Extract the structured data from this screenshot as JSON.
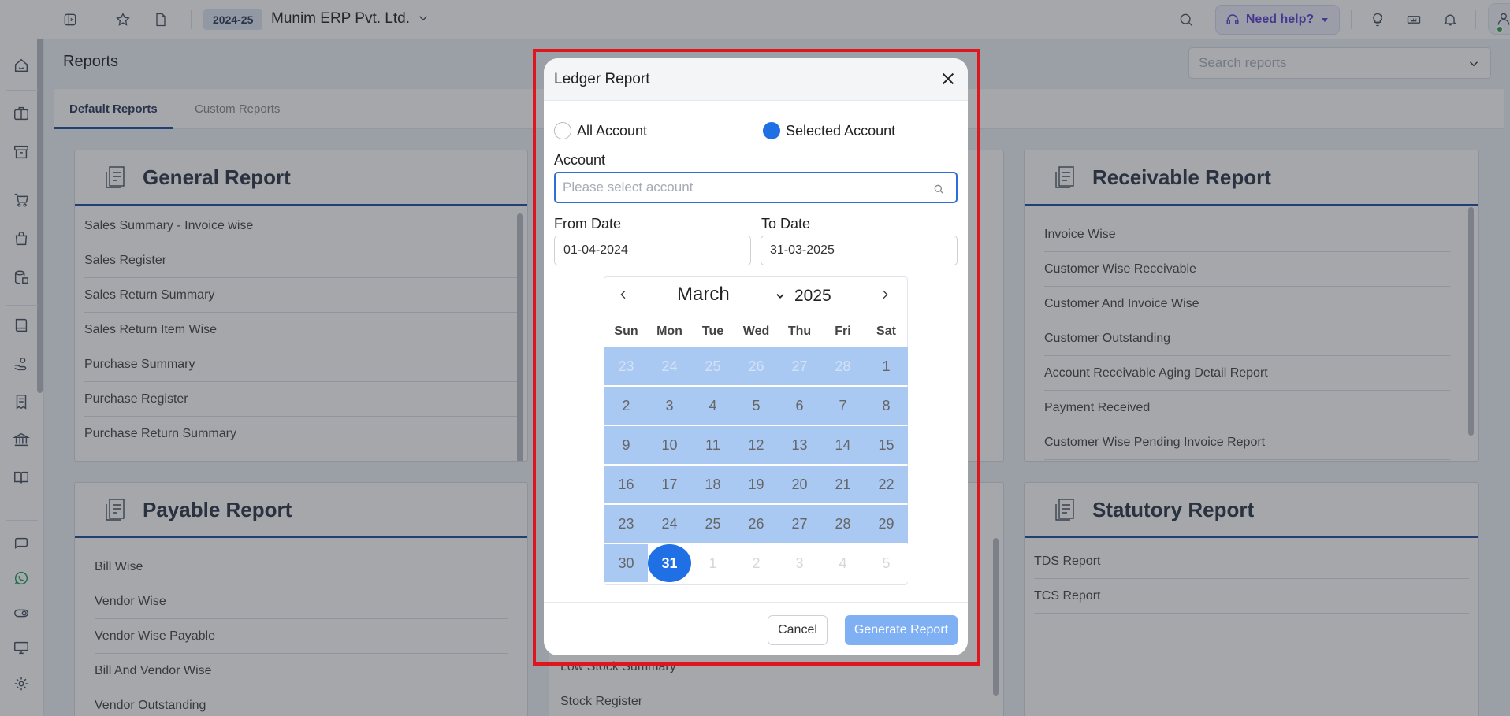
{
  "topbar": {
    "fy_badge": "2024-25",
    "company": "Munim ERP Pvt. Ltd.",
    "help_label": "Need help?"
  },
  "page": {
    "title": "Reports",
    "search_placeholder": "Search reports"
  },
  "tabs": [
    "Default Reports",
    "Custom Reports"
  ],
  "cards": {
    "general": {
      "title": "General Report",
      "items": [
        "Sales Summary - Invoice wise",
        "Sales Register",
        "Sales Return Summary",
        "Sales Return Item Wise",
        "Purchase Summary",
        "Purchase Register",
        "Purchase Return Summary"
      ]
    },
    "receivable": {
      "title": "Receivable Report",
      "items": [
        "Invoice Wise",
        "Customer Wise Receivable",
        "Customer And Invoice Wise",
        "Customer Outstanding",
        "Account Receivable Aging Detail Report",
        "Payment Received",
        "Customer Wise Pending Invoice Report"
      ]
    },
    "payable": {
      "title": "Payable Report",
      "items": [
        "Bill Wise",
        "Vendor Wise",
        "Vendor Wise Payable",
        "Bill And Vendor Wise",
        "Vendor Outstanding"
      ]
    },
    "inventory": {
      "items": [
        "Low Stock Summary",
        "Stock Register"
      ]
    },
    "statutory": {
      "title": "Statutory Report",
      "items": [
        "TDS Report",
        "TCS Report"
      ]
    }
  },
  "modal": {
    "title": "Ledger Report",
    "radio_all": "All Account",
    "radio_selected": "Selected Account",
    "selected_option": "Selected Account",
    "account_label": "Account",
    "account_placeholder": "Please select account",
    "from_label": "From Date",
    "from_value": "01-04-2024",
    "to_label": "To Date",
    "to_value": "31-03-2025",
    "cancel": "Cancel",
    "generate": "Generate Report"
  },
  "calendar": {
    "month": "March",
    "year": "2025",
    "weekdays": [
      "Sun",
      "Mon",
      "Tue",
      "Wed",
      "Thu",
      "Fri",
      "Sat"
    ],
    "selected_day": "31",
    "weeks": [
      [
        "23",
        "24",
        "25",
        "26",
        "27",
        "28",
        "1"
      ],
      [
        "2",
        "3",
        "4",
        "5",
        "6",
        "7",
        "8"
      ],
      [
        "9",
        "10",
        "11",
        "12",
        "13",
        "14",
        "15"
      ],
      [
        "16",
        "17",
        "18",
        "19",
        "20",
        "21",
        "22"
      ],
      [
        "23",
        "24",
        "25",
        "26",
        "27",
        "28",
        "29"
      ],
      [
        "30",
        "31",
        "1",
        "2",
        "3",
        "4",
        "5"
      ]
    ]
  },
  "icons": {
    "sidebar": [
      "home-icon",
      "briefcase-icon",
      "archive-icon",
      "cart-icon",
      "bag-icon",
      "database-icon",
      "book-icon",
      "hand-coin-icon",
      "receipt-icon",
      "bank-icon",
      "open-book-icon",
      "chat-icon",
      "whatsapp-icon",
      "toggle-icon",
      "monitor-icon",
      "gear-icon"
    ]
  },
  "colors": {
    "accent": "#1f6fe5",
    "highlight_border": "#e0161e",
    "range_fill": "#a9c8f2",
    "heading_rule": "#1a4fa0"
  }
}
